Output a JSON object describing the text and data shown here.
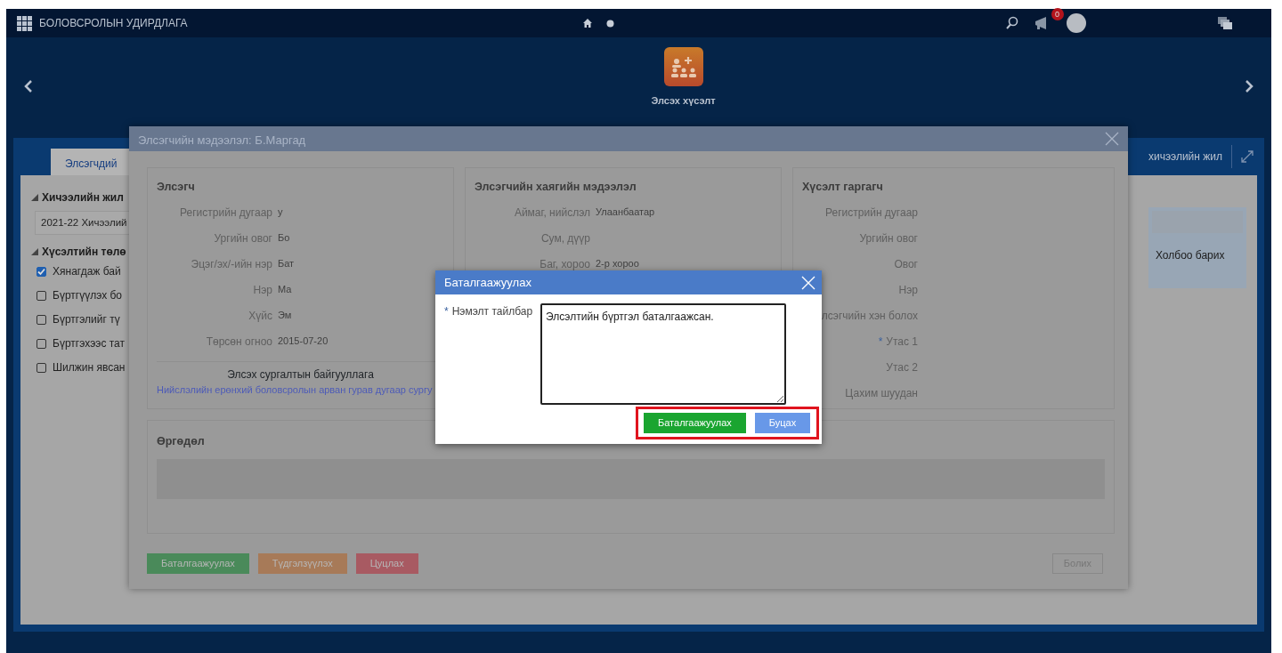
{
  "top_bar": {
    "title": "БОЛОВСРОЛЫН УДИРДЛАГА",
    "notification_count": "0"
  },
  "header": {
    "app_label": "Элсэх хүсэлт"
  },
  "background_panel": {
    "tab": "Элсэгчдий",
    "right_tab": "хичээлийн жил",
    "filters": [
      {
        "title": "Хичээлийн жил",
        "select_value": "2021-22 Хичээлий"
      },
      {
        "title": "Хүсэлтийн төлө",
        "options": [
          {
            "label": "Хянагдаж бай",
            "checked": true
          },
          {
            "label": "Бүртгүүлэх бо",
            "checked": false
          },
          {
            "label": "Бүртгэлийг тү",
            "checked": false
          },
          {
            "label": "Бүртгэхээс тат",
            "checked": false
          },
          {
            "label": "Шилжин явсан",
            "checked": false
          }
        ]
      }
    ],
    "contact_label": "Холбоо барих"
  },
  "applicant_modal": {
    "title": "Элсэгчийн мэдээлэл: Б.Маргад",
    "sections": [
      {
        "title": "Элсэгч",
        "rows": [
          {
            "label": "Регистрийн дугаар",
            "value": "у"
          },
          {
            "label": "Ургийн овог",
            "value": "Бо"
          },
          {
            "label": "Эцэг/эх/-ийн нэр",
            "value": "Бат"
          },
          {
            "label": "Нэр",
            "value": "Ма"
          },
          {
            "label": "Хүйс",
            "value": "Эм"
          },
          {
            "label": "Төрсөн огноо",
            "value": "2015-07-20"
          }
        ],
        "school_label": "Элсэх сургалтын байгууллага",
        "school_link": "Нийслэлийн ерөнхий боловсролын арван гурав дугаар сургу"
      },
      {
        "title": "Элсэгчийн хаягийн мэдээлэл",
        "rows": [
          {
            "label": "Аймаг, нийслэл",
            "value": "Улаанбаатар"
          },
          {
            "label": "Сум, дүүр"
          },
          {
            "label": "Баг, хороо",
            "value": "2-р хороо"
          }
        ]
      },
      {
        "title": "Хүсэлт гаргагч",
        "rows": [
          {
            "label": "Регистрийн дугаар"
          },
          {
            "label": "Ургийн овог"
          },
          {
            "label": "Овог"
          },
          {
            "label": "Нэр"
          },
          {
            "label": "лсэгчийн хэн болох"
          },
          {
            "label": "Утас 1",
            "required_mark": "*"
          },
          {
            "label": "Утас 2"
          },
          {
            "label": "Цахим шуудан"
          }
        ]
      }
    ],
    "application_title": "Өргөдөл",
    "actions": [
      {
        "label": "Баталгаажуулах",
        "kind": "success"
      },
      {
        "label": "Түдгэлзүүлэх",
        "kind": "warning"
      },
      {
        "label": "Цуцлах",
        "kind": "danger"
      }
    ],
    "cancel_label": "Болих"
  },
  "confirm_dialog": {
    "title": "Баталгаажуулах",
    "field_required_mark": "*",
    "field_label": "Нэмэлт тайлбар",
    "field_value": "Элсэлтийн бүртгэл баталгаажсан.",
    "buttons": [
      {
        "label": "Баталгаажуулах",
        "kind": "primary"
      },
      {
        "label": "Буцах",
        "kind": "secondary"
      }
    ]
  }
}
